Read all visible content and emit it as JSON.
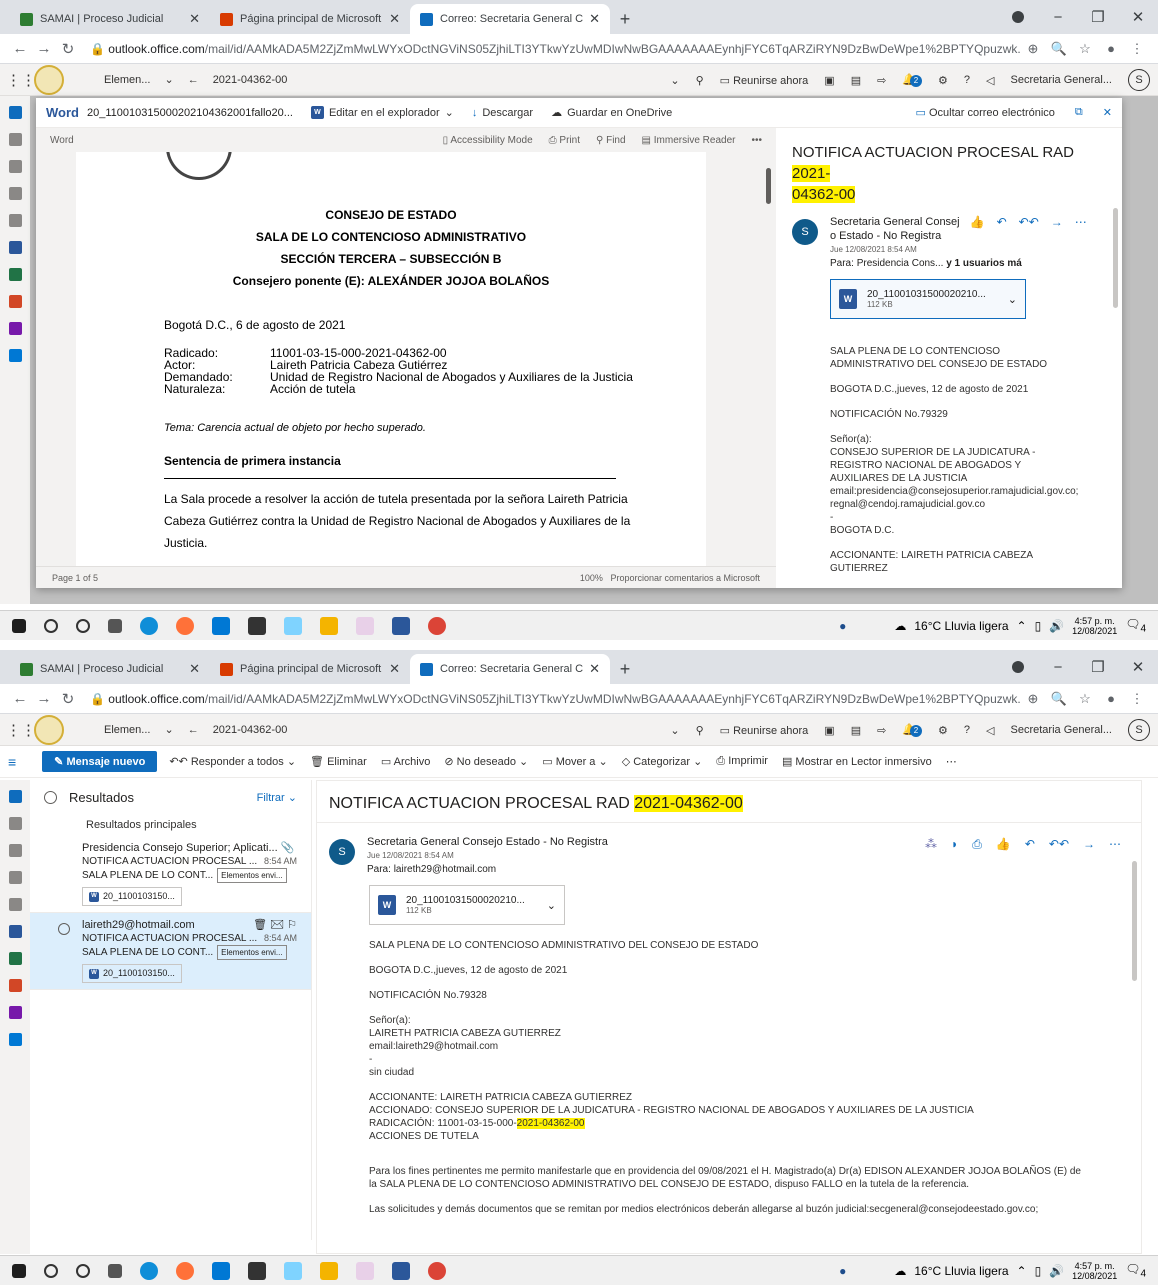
{
  "browser": {
    "tabs": [
      {
        "title": "SAMAI | Proceso Judicial",
        "color": "#2e7d32"
      },
      {
        "title": "Página principal de Microsoft Offi",
        "color": "#d83b01"
      },
      {
        "title": "Correo: Secretaria General Conse",
        "color": "#0f6cbd"
      }
    ],
    "url_domain": "outlook.office.com",
    "url_path": "/mail/id/AAMkADA5M2ZjZmMwLWYxODctNGViNS05ZjhiLTI3YTkwYzUwMDIwNwBGAAAAAAAEynhjFYC6TqARZiRYN9DzBwDeWpe1%2BPTYQpuzwk..."
  },
  "owa": {
    "folder": "Elemen...",
    "search_query": "2021-04362-00",
    "meet_now": "Reunirse ahora",
    "notif_count": "2",
    "account": "Secretaria General...",
    "avatar": "S"
  },
  "word_viewer": {
    "app": "Word",
    "filename": "20_110010315000202104362001fallo20...",
    "edit_in_browser": "Editar en el explorador",
    "download": "Descargar",
    "save_onedrive": "Guardar en OneDrive",
    "hide_email": "Ocultar correo electrónico",
    "label": "Word",
    "accessibility": "Accessibility Mode",
    "print": "Print",
    "find": "Find",
    "immersive": "Immersive Reader",
    "page_status": "Page 1 of 5",
    "zoom": "100%",
    "feedback": "Proporcionar comentarios a Microsoft"
  },
  "document": {
    "h1": "CONSEJO DE ESTADO",
    "h2": "SALA DE LO CONTENCIOSO ADMINISTRATIVO",
    "h3": "SECCIÓN TERCERA – SUBSECCIÓN B",
    "h4": "Consejero ponente (E): ALEXÁNDER JOJOA BOLAÑOS",
    "date": "Bogotá D.C., 6 de agosto de 2021",
    "fields": [
      {
        "k": "Radicado:",
        "v": "11001-03-15-000-2021-04362-00"
      },
      {
        "k": "Actor:",
        "v": "Laireth Patricia Cabeza Gutiérrez"
      },
      {
        "k": "Demandado:",
        "v": "Unidad de Registro Nacional de Abogados y Auxiliares de la Justicia"
      },
      {
        "k": "Naturaleza:",
        "v": "Acción de tutela"
      }
    ],
    "tema_label": "Tema",
    "tema": ": Carencia actual de objeto por hecho superado.",
    "sentencia": "Sentencia de primera instancia",
    "para1": "La Sala procede a resolver la acción de tutela presentada por la señora Laireth Patricia",
    "para2": "Cabeza Gutiérrez contra la Unidad de Registro Nacional de Abogados y Auxiliares de la",
    "para3": "Justicia."
  },
  "mail1": {
    "subject_pre": "NOTIFICA ACTUACION PROCESAL RAD ",
    "subject_hl1": "2021-",
    "subject_hl2": "04362-00",
    "sender_a": "Secretaria General Consej",
    "sender_b": "o Estado - No Registra",
    "date": "Jue 12/08/2021 8:54 AM",
    "to_label": "Para:",
    "to": "Presidencia Cons...",
    "to_more": "y 1 usuarios má",
    "att_name": "20_11001031500020210...",
    "att_size": "112 KB",
    "lines": [
      "SALA PLENA DE LO CONTENCIOSO ADMINISTRATIVO DEL CONSEJO DE ESTADO",
      "BOGOTA D.C.,jueves, 12 de agosto de 2021",
      "NOTIFICACIÓN No.79329",
      "Señor(a):",
      "CONSEJO SUPERIOR DE LA JUDICATURA - REGISTRO NACIONAL DE ABOGADOS Y AUXILIARES DE LA JUSTICIA",
      "email:presidencia@consejosuperior.ramajudicial.gov.co; regnal@cendoj.ramajudicial.gov.co",
      "-",
      "BOGOTA D.C.",
      "ACCIONANTE: LAIRETH PATRICIA CABEZA GUTIERREZ"
    ]
  },
  "taskbar": {
    "weather": "16°C  Lluvia ligera",
    "time": "4:57 p. m.",
    "date": "12/08/2021",
    "notif": "4"
  },
  "commands": {
    "new_message": "Mensaje nuevo",
    "reply_all": "Responder a todos",
    "delete": "Eliminar",
    "archive": "Archivo",
    "junk": "No deseado",
    "move": "Mover a",
    "categorize": "Categorizar",
    "print": "Imprimir",
    "immersive": "Mostrar en Lector inmersivo"
  },
  "list": {
    "title": "Resultados",
    "filter": "Filtrar",
    "section": "Resultados principales",
    "items": [
      {
        "from": "Presidencia Consejo Superior; Aplicati...",
        "subject": "NOTIFICA ACTUACION PROCESAL ...",
        "time": "8:54 AM",
        "preview": "SALA PLENA DE LO CONT...",
        "tag": "Elementos envi...",
        "att": "20_1100103150..."
      },
      {
        "from": "laireth29@hotmail.com",
        "subject": "NOTIFICA ACTUACION PROCESAL ...",
        "time": "8:54 AM",
        "preview": "SALA PLENA DE LO CONT...",
        "tag": "Elementos envi...",
        "att": "20_1100103150..."
      }
    ]
  },
  "mail2": {
    "subject_pre": "NOTIFICA ACTUACION PROCESAL RAD ",
    "subject_hl": "2021-04362-00",
    "sender": "Secretaria General Consejo Estado - No Registra",
    "date": "Jue 12/08/2021 8:54 AM",
    "to_label": "Para:",
    "to": "laireth29@hotmail.com",
    "att_name": "20_11001031500020210...",
    "att_size": "112 KB",
    "l1": "SALA PLENA DE LO CONTENCIOSO ADMINISTRATIVO DEL CONSEJO DE ESTADO",
    "l2": "BOGOTA D.C.,jueves, 12 de agosto de 2021",
    "l3": "NOTIFICACIÓN No.79328",
    "l4": "Señor(a):",
    "l5": "LAIRETH PATRICIA CABEZA GUTIERREZ",
    "l6": "email:laireth29@hotmail.com",
    "l7": "-",
    "l8": "sin ciudad",
    "l9": "ACCIONANTE: LAIRETH PATRICIA CABEZA GUTIERREZ",
    "l10": "ACCIONADO: CONSEJO SUPERIOR DE LA JUDICATURA - REGISTRO NACIONAL DE ABOGADOS Y AUXILIARES DE LA JUSTICIA",
    "l11_pre": "RADICACIÓN: 11001-03-15-000-",
    "l11_hl": "2021-04362-00",
    "l12": "ACCIONES DE TUTELA",
    "l13": "Para los fines pertinentes me permito manifestarle que en providencia del 09/08/2021  el H. Magistrado(a) Dr(a) EDISON ALEXANDER JOJOA BOLAÑOS (E) de la SALA PLENA DE LO CONTENCIOSO ADMINISTRATIVO DEL CONSEJO DE ESTADO, dispuso FALLO en la tutela de la referencia.",
    "l14": "Las solicitudes y demás documentos que se remitan por medios electrónicos deberán allegarse al buzón judicial:secgeneral@consejodeestado.gov.co;"
  }
}
